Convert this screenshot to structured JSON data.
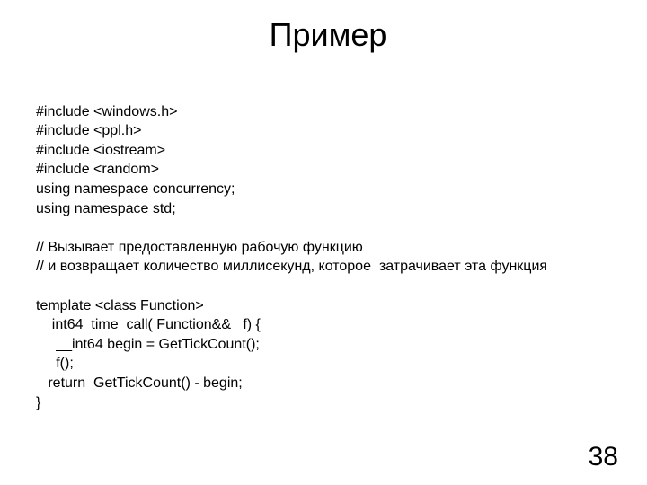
{
  "slide": {
    "title": "Пример",
    "code_lines": [
      "#include <windows.h>",
      "#include <ppl.h>",
      "#include <iostream>",
      "#include <random>",
      "using namespace concurrency;",
      "using namespace std;",
      "",
      "// Вызывает предоставленную рабочую функцию",
      "// и возвращает количество миллисекунд, которое  затрачивает эта функция",
      "",
      "template <class Function>",
      "__int64  time_call( Function&&   f) {",
      "     __int64 begin = GetTickCount();",
      "     f();",
      "   return  GetTickCount() - begin;",
      "}"
    ],
    "page_number": "38"
  }
}
